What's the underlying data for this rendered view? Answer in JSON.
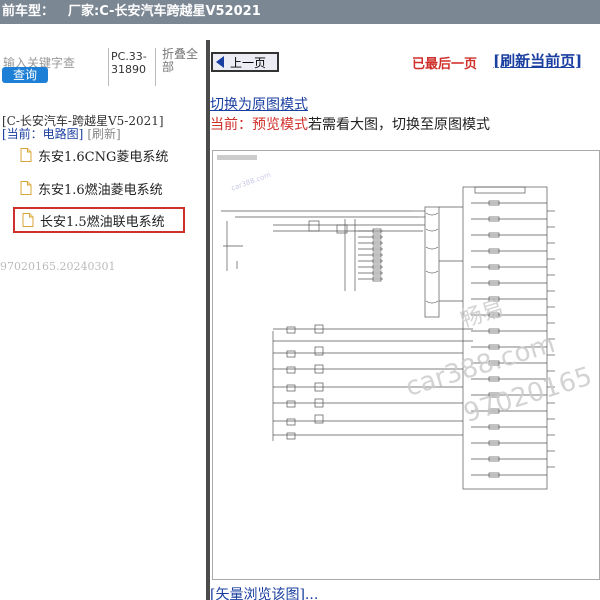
{
  "window": {
    "title_prefix": "前车型：",
    "title_vendor": "厂家:C-长安汽车跨越星V52021"
  },
  "left": {
    "search_placeholder": "输入关键字查",
    "search_button": "查询",
    "pc_text": "PC.33-31890",
    "collapse_all": "折叠全部",
    "tree_root": "[C-长安汽车-跨越星V5-2021]",
    "current_label": "[当前：电路图]",
    "refresh": "[刷新]",
    "items": [
      {
        "label": "东安1.6CNG菱电系统"
      },
      {
        "label": "东安1.6燃油菱电系统"
      },
      {
        "label": "长安1.5燃油联电系统"
      }
    ],
    "version": "97020165.20240301"
  },
  "right": {
    "prev_page": "上一页",
    "last_page": "已最后一页",
    "refresh_page": "[刷新当前页]",
    "switch_mode": "切换为原图模式",
    "mode_current": "当前：预览模式",
    "mode_hint": "若需看大图，切换至原图模式",
    "vector_prefix": "[",
    "vector_link": "[矢量浏览该图]...",
    "vector_suffix": "]",
    "watermark_brand": "畅易",
    "watermark_site": "car388.com",
    "watermark_code": "97020165",
    "diagram_small_wm": "car388.com"
  },
  "colors": {
    "title_bg": "#7c8794",
    "accent_blue": "#1a3fa0",
    "button_blue": "#1e7fd6",
    "accent_red": "#d0302b",
    "splitter": "#4c4c4c"
  }
}
